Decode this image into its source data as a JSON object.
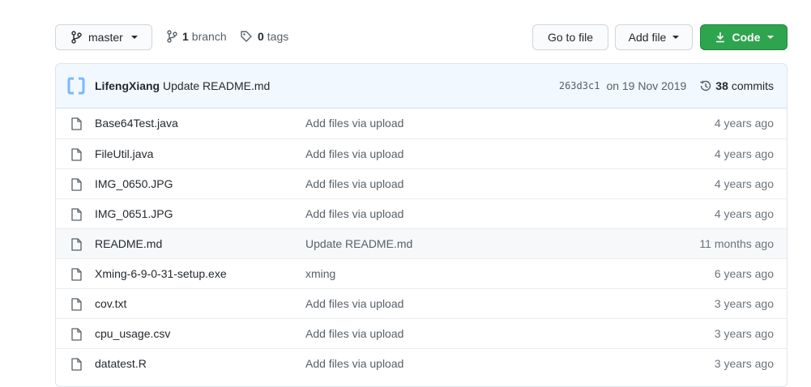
{
  "toolbar": {
    "branch_name": "master",
    "branches_count": "1",
    "branches_label": "branch",
    "tags_count": "0",
    "tags_label": "tags",
    "go_to_file_label": "Go to file",
    "add_file_label": "Add file",
    "code_label": "Code"
  },
  "commit": {
    "author": "LifengXiang",
    "message": "Update README.md",
    "sha": "263d3c1",
    "date": "on 19 Nov 2019",
    "commits_count": "38",
    "commits_label": "commits"
  },
  "files": [
    {
      "name": "Base64Test.java",
      "message": "Add files via upload",
      "age": "4 years ago"
    },
    {
      "name": "FileUtil.java",
      "message": "Add files via upload",
      "age": "4 years ago"
    },
    {
      "name": "IMG_0650.JPG",
      "message": "Add files via upload",
      "age": "4 years ago"
    },
    {
      "name": "IMG_0651.JPG",
      "message": "Add files via upload",
      "age": "4 years ago"
    },
    {
      "name": "README.md",
      "message": "Update README.md",
      "age": "11 months ago"
    },
    {
      "name": "Xming-6-9-0-31-setup.exe",
      "message": "xming",
      "age": "6 years ago"
    },
    {
      "name": "cov.txt",
      "message": "Add files via upload",
      "age": "3 years ago"
    },
    {
      "name": "cpu_usage.csv",
      "message": "Add files via upload",
      "age": "3 years ago"
    },
    {
      "name": "datatest.R",
      "message": "Add files via upload",
      "age": "3 years ago"
    }
  ],
  "colors": {
    "code_button": "#2ea44f",
    "commit_bar": "#f1f8ff",
    "highlight_row": "#f6f8fa"
  }
}
